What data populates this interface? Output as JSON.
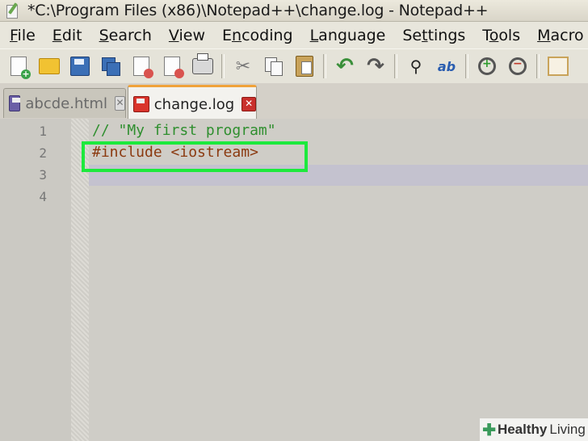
{
  "window": {
    "title": "*C:\\Program Files (x86)\\Notepad++\\change.log - Notepad++"
  },
  "menu": [
    {
      "u": "F",
      "rest": "ile"
    },
    {
      "u": "E",
      "rest": "dit"
    },
    {
      "u": "S",
      "rest": "earch"
    },
    {
      "u": "V",
      "rest": "iew"
    },
    {
      "pre": "E",
      "u": "n",
      "rest": "coding"
    },
    {
      "u": "L",
      "rest": "anguage"
    },
    {
      "pre": "Se",
      "u": "t",
      "rest": "tings"
    },
    {
      "pre": "T",
      "u": "o",
      "rest": "ols"
    },
    {
      "u": "M",
      "rest": "acro"
    }
  ],
  "tabs": [
    {
      "label": "abcde.html",
      "close": "✕",
      "active": false
    },
    {
      "label": "change.log",
      "close": "✕",
      "active": true
    }
  ],
  "editor": {
    "line_numbers": [
      "1",
      "2",
      "3",
      "4"
    ],
    "lines": [
      {
        "text": "// \"My first program\"",
        "kind": "comment"
      },
      {
        "text": "#include <iostream>",
        "kind": "preproc"
      },
      {
        "text": "",
        "kind": "plain"
      },
      {
        "text": "",
        "kind": "plain"
      }
    ],
    "current_line": 3
  },
  "icons": [
    "new-file-icon",
    "open-folder-icon",
    "save-icon",
    "save-all-icon",
    "close-icon",
    "close-all-icon",
    "print-icon",
    "cut-icon",
    "copy-icon",
    "paste-icon",
    "undo-icon",
    "redo-icon",
    "find-icon",
    "replace-icon",
    "zoom-in-icon",
    "zoom-out-icon",
    "sync-scroll-icon"
  ],
  "watermark": {
    "brand1": "Healthy",
    "brand2": "Living"
  },
  "colors": {
    "highlight_box": "#1de93d",
    "active_tab_accent": "#f0a23a",
    "comment": "#2f8f2f",
    "preproc": "#8b3a10"
  }
}
